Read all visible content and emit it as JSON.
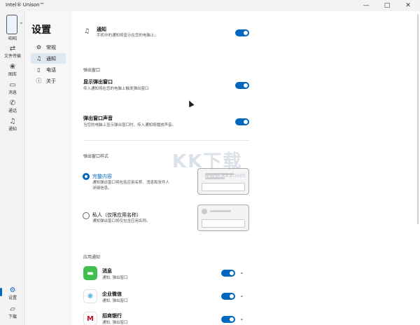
{
  "window": {
    "title": "Intel® Unison™",
    "controls": {
      "minimize": "—",
      "maximize": "□",
      "close": "✕"
    }
  },
  "rail": {
    "device_label": "昭昭",
    "items": [
      {
        "label": "文件传输",
        "icon": "transfer-icon"
      },
      {
        "label": "图库",
        "icon": "gallery-icon"
      },
      {
        "label": "消息",
        "icon": "message-icon"
      },
      {
        "label": "通话",
        "icon": "phone-icon"
      },
      {
        "label": "通知",
        "icon": "bell-icon"
      }
    ],
    "bottom": [
      {
        "label": "设置",
        "icon": "gear-icon"
      },
      {
        "label": "下载",
        "icon": "folder-icon"
      }
    ]
  },
  "settings": {
    "title": "设置",
    "menu": [
      {
        "label": "常规",
        "icon": "gear-icon"
      },
      {
        "label": "通知",
        "icon": "bell-icon",
        "active": true
      },
      {
        "label": "电话",
        "icon": "phone-device-icon"
      },
      {
        "label": "关于",
        "icon": "info-icon"
      }
    ]
  },
  "content": {
    "notifications": {
      "title": "通知",
      "desc": "手机中的通知将显示在您的电脑上。",
      "enabled": true
    },
    "popup_section": "弹出窗口",
    "show_popup": {
      "title": "显示弹出窗口",
      "desc": "传入通知将在您的电脑上触发弹出窗口",
      "enabled": true
    },
    "popup_sound": {
      "title": "弹出窗口声音",
      "desc": "当您的电脑上显示弹出窗口时，传入通知将播放声音。",
      "enabled": true
    },
    "popup_style_section": "弹出窗口样式",
    "style_full": {
      "label": "完整内容",
      "desc_line1": "通知弹出窗口将包括应用名称、消息和发件人",
      "desc_line2": "详细信息。",
      "checked": true
    },
    "style_private": {
      "label": "私人（仅限应用名称）",
      "desc": "通知弹出窗口将仅包含应用名称。",
      "checked": false
    },
    "app_section": "应用通知",
    "apps": [
      {
        "name": "消息",
        "desc": "通知, 弹出窗口",
        "enabled": true,
        "color": "#3fbf4f"
      },
      {
        "name": "企业微信",
        "desc": "通知, 弹出窗口",
        "enabled": true,
        "color": "#ffffff"
      },
      {
        "name": "招商银行",
        "desc": "通知, 弹出窗口",
        "enabled": true,
        "color": "#ffffff"
      }
    ]
  },
  "watermark": {
    "text": "KK下载",
    "sub": "www.kkx.net"
  }
}
